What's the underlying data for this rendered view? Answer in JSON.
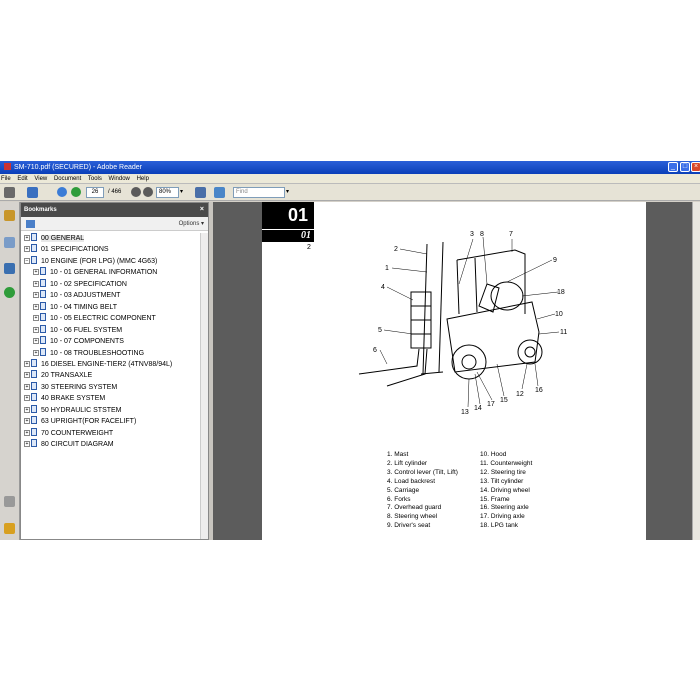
{
  "window": {
    "title": "SM-710.pdf (SECURED) - Adobe Reader",
    "controls": [
      "_",
      "□",
      "×"
    ]
  },
  "menu": [
    "File",
    "Edit",
    "View",
    "Document",
    "Tools",
    "Window",
    "Help"
  ],
  "toolbar": {
    "page_current": "26",
    "page_total": "/ 466",
    "zoom": "80%",
    "zoom_arrow": "▾",
    "find_placeholder": "Find",
    "find_arrow": "▾"
  },
  "bookmarks": {
    "title": "Bookmarks",
    "close": "×",
    "options": "Options ▾",
    "items": [
      {
        "label": "00  GENERAL",
        "level": 0,
        "expander": "+",
        "selected": true
      },
      {
        "label": "01  SPECIFICATIONS",
        "level": 0,
        "expander": "+"
      },
      {
        "label": "10  ENGINE (FOR LPG) (MMC 4G63)",
        "level": 0,
        "expander": "−"
      },
      {
        "label": "10 - 01 GENERAL INFORMATION",
        "level": 1,
        "expander": "+"
      },
      {
        "label": "10 - 02 SPECIFICATION",
        "level": 1,
        "expander": "+"
      },
      {
        "label": "10 - 03 ADJUSTMENT",
        "level": 1,
        "expander": "+"
      },
      {
        "label": "10 - 04 TIMING BELT",
        "level": 1,
        "expander": "+"
      },
      {
        "label": "10 - 05 ELECTRIC COMPONENT",
        "level": 1,
        "expander": "+"
      },
      {
        "label": "10 - 06 FUEL SYSTEM",
        "level": 1,
        "expander": "+"
      },
      {
        "label": "10 - 07 COMPONENTS",
        "level": 1,
        "expander": "+"
      },
      {
        "label": "10 - 08 TROUBLESHOOTING",
        "level": 1,
        "expander": "+"
      },
      {
        "label": "16  DIESEL ENGINE-TIER2 (4TNV88/94L)",
        "level": 0,
        "expander": "+"
      },
      {
        "label": "20  TRANSAXLE",
        "level": 0,
        "expander": "+"
      },
      {
        "label": "30  STEERING SYSTEM",
        "level": 0,
        "expander": "+"
      },
      {
        "label": "40  BRAKE SYSTEM",
        "level": 0,
        "expander": "+"
      },
      {
        "label": "50  HYDRAULIC STSTEM",
        "level": 0,
        "expander": "+"
      },
      {
        "label": "63  UPRIGHT(FOR FACELIFT)",
        "level": 0,
        "expander": "+"
      },
      {
        "label": "70  COUNTERWEIGHT",
        "level": 0,
        "expander": "+"
      },
      {
        "label": "80  CIRCUIT DIAGRAM",
        "level": 0,
        "expander": "+"
      }
    ]
  },
  "document": {
    "section_number": "01",
    "section_italic": "01",
    "page_number": "2",
    "callouts": [
      "1",
      "2",
      "3",
      "4",
      "5",
      "6",
      "7",
      "8",
      "9",
      "10",
      "11",
      "12",
      "13",
      "14",
      "15",
      "16",
      "17",
      "18"
    ],
    "legend_left": [
      "1.  Mast",
      "2.  Lift cylinder",
      "3.  Control lever (Tilt, Lift)",
      "4.  Load backrest",
      "5.  Carriage",
      "6.  Forks",
      "7.  Overhead guard",
      "8.  Steering wheel",
      "9.  Driver's seat"
    ],
    "legend_right": [
      "10.  Hood",
      "11.  Counterweight",
      "12.  Steering tire",
      "13.  Tilt cylinder",
      "14.  Driving wheel",
      "15.  Frame",
      "16.  Steering axle",
      "17.  Driving axle",
      "18.  LPG tank"
    ]
  }
}
